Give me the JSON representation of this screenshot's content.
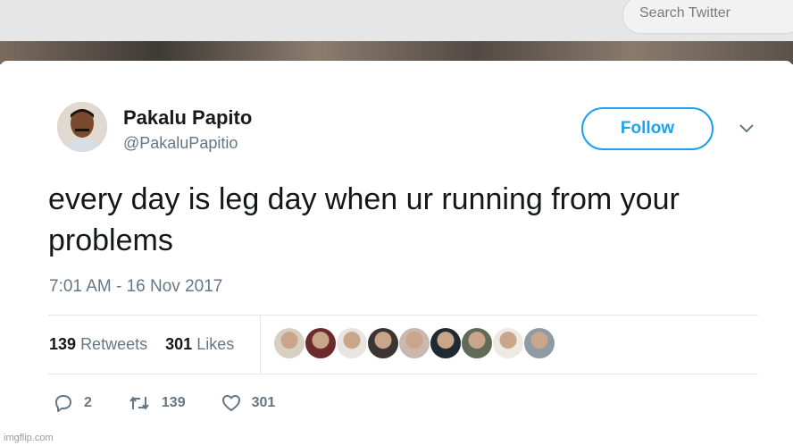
{
  "search": {
    "placeholder": "Search Twitter"
  },
  "tweet": {
    "author_name": "Pakalu Papito",
    "author_handle": "@PakaluPapitio",
    "follow_label": "Follow",
    "text": "every day is leg day when ur running from your problems",
    "timestamp": "7:01 AM - 16 Nov 2017",
    "retweet_count": "139",
    "retweet_label": "Retweets",
    "like_count": "301",
    "like_label": "Likes"
  },
  "actions": {
    "reply_count": "2",
    "retweet_count": "139",
    "like_count": "301"
  },
  "liker_avatars": [
    {
      "name": "liker-avatar-1",
      "color": "#d8cfc4"
    },
    {
      "name": "liker-avatar-2",
      "color": "#6b2b2b"
    },
    {
      "name": "liker-avatar-3",
      "color": "#e8e4df"
    },
    {
      "name": "liker-avatar-4",
      "color": "#3a3532"
    },
    {
      "name": "liker-avatar-5",
      "color": "#c8b8b0"
    },
    {
      "name": "liker-avatar-6",
      "color": "#1f2a33"
    },
    {
      "name": "liker-avatar-7",
      "color": "#5f6a58"
    },
    {
      "name": "liker-avatar-8",
      "color": "#efe9e4"
    },
    {
      "name": "liker-avatar-9",
      "color": "#8f9aa3"
    }
  ],
  "watermark": "imgflip.com",
  "colors": {
    "accent": "#1da1f2",
    "text": "#14171a",
    "muted": "#657786"
  }
}
